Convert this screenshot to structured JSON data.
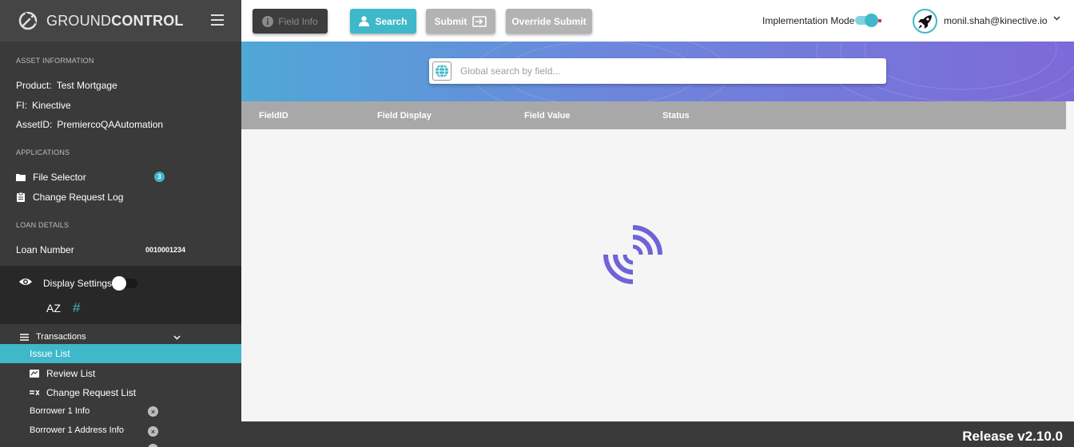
{
  "app": {
    "brand_light": "GROUND",
    "brand_bold": "CONTROL"
  },
  "asset_info": {
    "title": "ASSET INFORMATION",
    "product_label": "Product:",
    "product_value": "Test Mortgage",
    "fi_label": "FI:",
    "fi_value": "Kinective",
    "asset_label": "AssetID:",
    "asset_value": "PremiercoQAAutomation"
  },
  "applications": {
    "title": "APPLICATIONS",
    "file_selector": "File Selector",
    "file_selector_badge": "3",
    "change_request_log": "Change Request Log"
  },
  "loan_details": {
    "title": "LOAN DETAILS",
    "loan_number_label": "Loan Number",
    "loan_number_value": "0010001234"
  },
  "display_settings": {
    "label": "Display Settings",
    "sort_icon_text": "AZ",
    "hash_icon_text": "#"
  },
  "transactions": {
    "label": "Transactions",
    "issue_list": "Issue List",
    "review_list": "Review List",
    "change_request_list": "Change Request List",
    "borrower1_info": "Borrower 1 Info",
    "borrower1_address": "Borrower 1 Address Info"
  },
  "toolbar": {
    "field_info": "Field Info",
    "search": "Search",
    "submit": "Submit",
    "override_submit": "Override Submit",
    "implementation_mode": "Implementation Mode",
    "implementation_mode_on": true,
    "user_email": "monil.shah@kinective.io"
  },
  "search": {
    "placeholder": "Global search by field..."
  },
  "table": {
    "columns": [
      "FieldID",
      "Field Display",
      "Field Value",
      "Status"
    ]
  },
  "footer": {
    "release": "Release v2.10.0"
  },
  "colors": {
    "accent": "#3fb8c9",
    "sidebar": "#3a3a3a",
    "spinner": "#6f63d6"
  },
  "icons": [
    "groundcontrol-logo-icon",
    "hamburger-icon",
    "folder-icon",
    "clipboard-icon",
    "eye-icon",
    "sort-az-icon",
    "hash-icon",
    "list-icon",
    "chevron-down-icon",
    "review-icon",
    "change-list-icon",
    "close-circle-icon",
    "info-icon",
    "user-icon",
    "submit-arrow-icon",
    "rocket-icon",
    "globe-icon",
    "loading-spinner-icon"
  ]
}
